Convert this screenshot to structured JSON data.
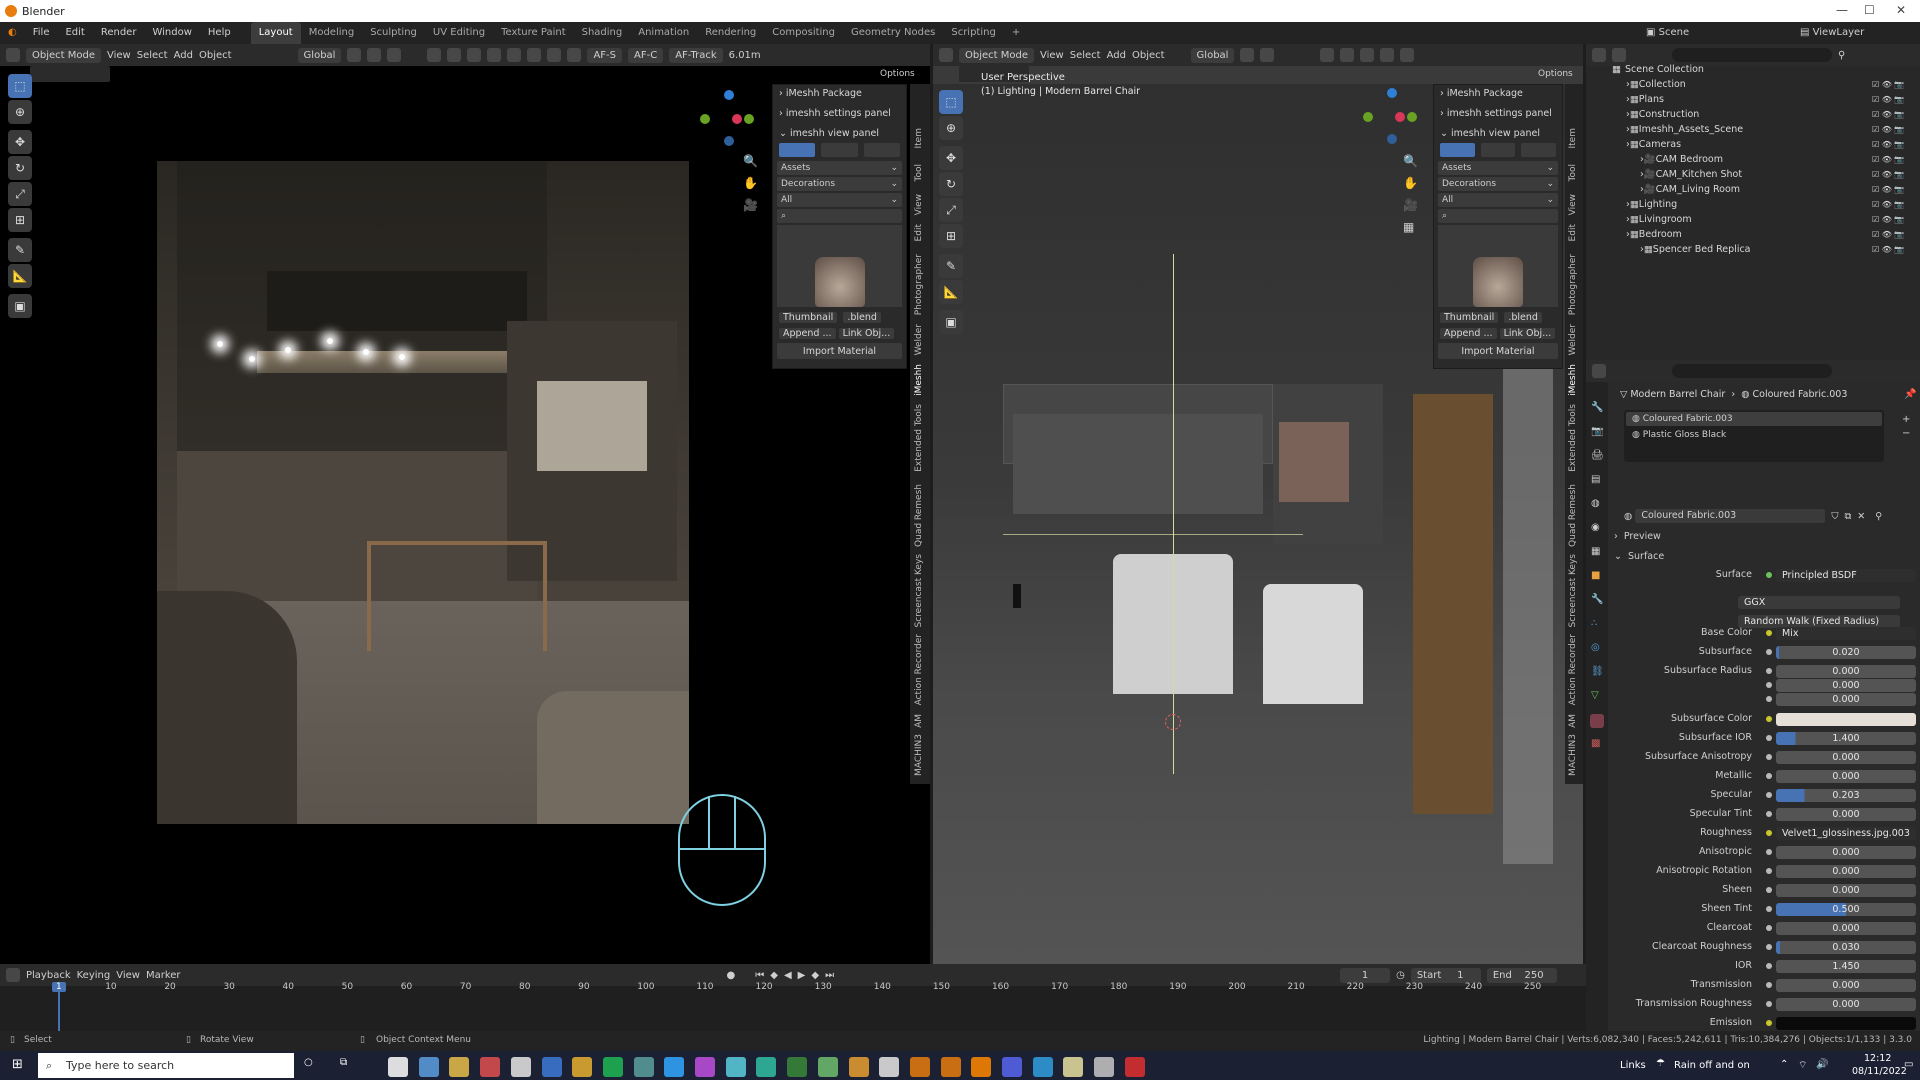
{
  "window": {
    "title": "Blender"
  },
  "menubar": {
    "menus": [
      "File",
      "Edit",
      "Render",
      "Window",
      "Help"
    ],
    "workspaces": [
      "Layout",
      "Modeling",
      "Sculpting",
      "UV Editing",
      "Texture Paint",
      "Shading",
      "Animation",
      "Rendering",
      "Compositing",
      "Geometry Nodes",
      "Scripting"
    ],
    "active_workspace": "Layout",
    "scene": "Scene",
    "view_layer": "ViewLayer"
  },
  "left_view": {
    "header": {
      "mode": "Object Mode",
      "menus": [
        "View",
        "Select",
        "Add",
        "Object"
      ],
      "transform": "Global",
      "af_s": "AF-S",
      "af_c": "AF-C",
      "af_track": "AF-Track",
      "focal": "6.01m"
    },
    "options": "Options"
  },
  "right_view": {
    "header": {
      "mode": "Object Mode",
      "menus": [
        "View",
        "Select",
        "Add",
        "Object"
      ],
      "transform": "Global"
    },
    "options": "Options",
    "overlay_line1": "User Perspective",
    "overlay_line2": "(1) Lighting | Modern Barrel Chair"
  },
  "imeshh_panel": {
    "package": "iMeshh Package",
    "settings": "imeshh settings panel",
    "view": "imeshh view panel",
    "assets": "Assets",
    "decorations": "Decorations",
    "all": "All",
    "thumbnail": "Thumbnail",
    "blend": ".blend",
    "append": "Append ...",
    "link": "Link Obj...",
    "import": "Import Material"
  },
  "sidebar_tabs_left": [
    "Item",
    "Tool",
    "View",
    "Edit",
    "Photographer",
    "Welder",
    "iMeshh",
    "Extended Tools",
    "Quad Remesh",
    "Screencast Keys",
    "Action Recorder",
    "AM",
    "MACHIN3"
  ],
  "sidebar_tabs_right": [
    "Item",
    "Tool",
    "View",
    "Edit",
    "Photographer",
    "Welder",
    "iMeshh",
    "Extended Tools",
    "Quad Remesh",
    "Screencast Keys",
    "Action Recorder",
    "AM",
    "MACHIN3"
  ],
  "outliner": {
    "root": "Scene Collection",
    "items": [
      {
        "name": "Collection",
        "indent": 1
      },
      {
        "name": "Plans",
        "indent": 1
      },
      {
        "name": "Construction",
        "indent": 1
      },
      {
        "name": "Imeshh_Assets_Scene",
        "indent": 1
      },
      {
        "name": "Cameras",
        "indent": 1
      },
      {
        "name": "CAM Bedroom",
        "indent": 2
      },
      {
        "name": "CAM_Kitchen Shot",
        "indent": 2
      },
      {
        "name": "CAM_Living Room",
        "indent": 2
      },
      {
        "name": "Lighting",
        "indent": 1
      },
      {
        "name": "Livingroom",
        "indent": 1
      },
      {
        "name": "Bedroom",
        "indent": 1
      },
      {
        "name": "Spencer Bed Replica",
        "indent": 2
      }
    ]
  },
  "properties": {
    "breadcrumb_object": "Modern Barrel Chair",
    "breadcrumb_material": "Coloured Fabric.003",
    "slots": [
      "Coloured Fabric.003",
      "Plastic Gloss Black"
    ],
    "material_name": "Coloured Fabric.003",
    "preview": "Preview",
    "surface_section": "Surface",
    "surface_label": "Surface",
    "surface_value": "Principled BSDF",
    "distribution": "GGX",
    "subsurface_method": "Random Walk (Fixed Radius)",
    "rows": [
      {
        "label": "Base Color",
        "value": "Mix",
        "kind": "link"
      },
      {
        "label": "Subsurface",
        "value": "0.020",
        "fill": 0.02
      },
      {
        "label": "Subsurface Radius",
        "value": "0.000",
        "fill": 0
      },
      {
        "label": "",
        "value": "0.000",
        "fill": 0
      },
      {
        "label": "",
        "value": "0.000",
        "fill": 0
      },
      {
        "label": "Subsurface Color",
        "value": "",
        "kind": "color",
        "color": "#e6dfd8"
      },
      {
        "label": "Subsurface IOR",
        "value": "1.400",
        "fill": 0.14
      },
      {
        "label": "Subsurface Anisotropy",
        "value": "0.000",
        "fill": 0
      },
      {
        "label": "Metallic",
        "value": "0.000",
        "fill": 0
      },
      {
        "label": "Specular",
        "value": "0.203",
        "fill": 0.203
      },
      {
        "label": "Specular Tint",
        "value": "0.000",
        "fill": 0
      },
      {
        "label": "Roughness",
        "value": "Velvet1_glossiness.jpg.003",
        "kind": "link"
      },
      {
        "label": "Anisotropic",
        "value": "0.000",
        "fill": 0
      },
      {
        "label": "Anisotropic Rotation",
        "value": "0.000",
        "fill": 0
      },
      {
        "label": "Sheen",
        "value": "0.000",
        "fill": 0
      },
      {
        "label": "Sheen Tint",
        "value": "0.500",
        "fill": 0.5
      },
      {
        "label": "Clearcoat",
        "value": "0.000",
        "fill": 0
      },
      {
        "label": "Clearcoat Roughness",
        "value": "0.030",
        "fill": 0.03
      },
      {
        "label": "IOR",
        "value": "1.450",
        "fill": 0.0
      },
      {
        "label": "Transmission",
        "value": "0.000",
        "fill": 0
      },
      {
        "label": "Transmission Roughness",
        "value": "0.000",
        "fill": 0
      },
      {
        "label": "Emission",
        "value": "",
        "kind": "color",
        "color": "#0a0a0a"
      }
    ]
  },
  "timeline": {
    "menus": [
      "Playback",
      "Keying",
      "View",
      "Marker"
    ],
    "current_frame": "1",
    "start_label": "Start",
    "start": "1",
    "end_label": "End",
    "end": "250",
    "ticks": [
      "1",
      "10",
      "20",
      "30",
      "40",
      "50",
      "60",
      "70",
      "80",
      "90",
      "100",
      "110",
      "120",
      "130",
      "140",
      "150",
      "160",
      "170",
      "180",
      "190",
      "200",
      "210",
      "220",
      "230",
      "240",
      "250"
    ]
  },
  "statusbar": {
    "select": "Select",
    "rotate": "Rotate View",
    "context": "Object Context Menu",
    "info": "Lighting | Modern Barrel Chair | Verts:6,082,340 | Faces:5,242,611 | Tris:10,384,276 | Objects:1/1,133 | 3.3.0"
  },
  "taskbar": {
    "search_placeholder": "Type here to search",
    "links": "Links",
    "weather": "Rain off and on",
    "time": "12:12",
    "date": "08/11/2022"
  }
}
